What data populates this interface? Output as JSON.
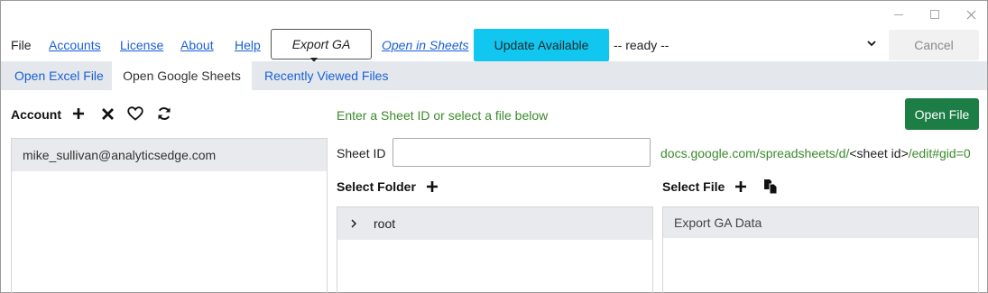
{
  "menu": {
    "file": "File",
    "accounts": "Accounts",
    "license": "License",
    "about": "About",
    "help": "Help",
    "export_button": "Export GA",
    "open_in_sheets": "Open in Sheets",
    "update_button": "Update Available",
    "status": "-- ready --",
    "cancel": "Cancel"
  },
  "tabs": [
    {
      "label": "Open Excel File"
    },
    {
      "label": "Open Google Sheets"
    },
    {
      "label": "Recently Viewed Files"
    }
  ],
  "account": {
    "label": "Account",
    "items": [
      "mike_sullivan@analyticsedge.com"
    ]
  },
  "main": {
    "hint": "Enter a Sheet ID or select a file below",
    "open_button": "Open File",
    "sheet_id_label": "Sheet ID",
    "sheet_id_value": "",
    "url_prefix": "docs.google.com/spreadsheets/d/",
    "url_mid": "<sheet id>",
    "url_suffix": "/edit#gid=0"
  },
  "folders": {
    "label": "Select Folder",
    "items": [
      "root"
    ]
  },
  "files": {
    "label": "Select File",
    "items": [
      "Export GA Data"
    ]
  },
  "colors": {
    "accent_link": "#1a5fd6",
    "update_bg": "#12c7ef",
    "open_file_bg": "#1c7d45",
    "hint_green": "#3a8a2a"
  }
}
